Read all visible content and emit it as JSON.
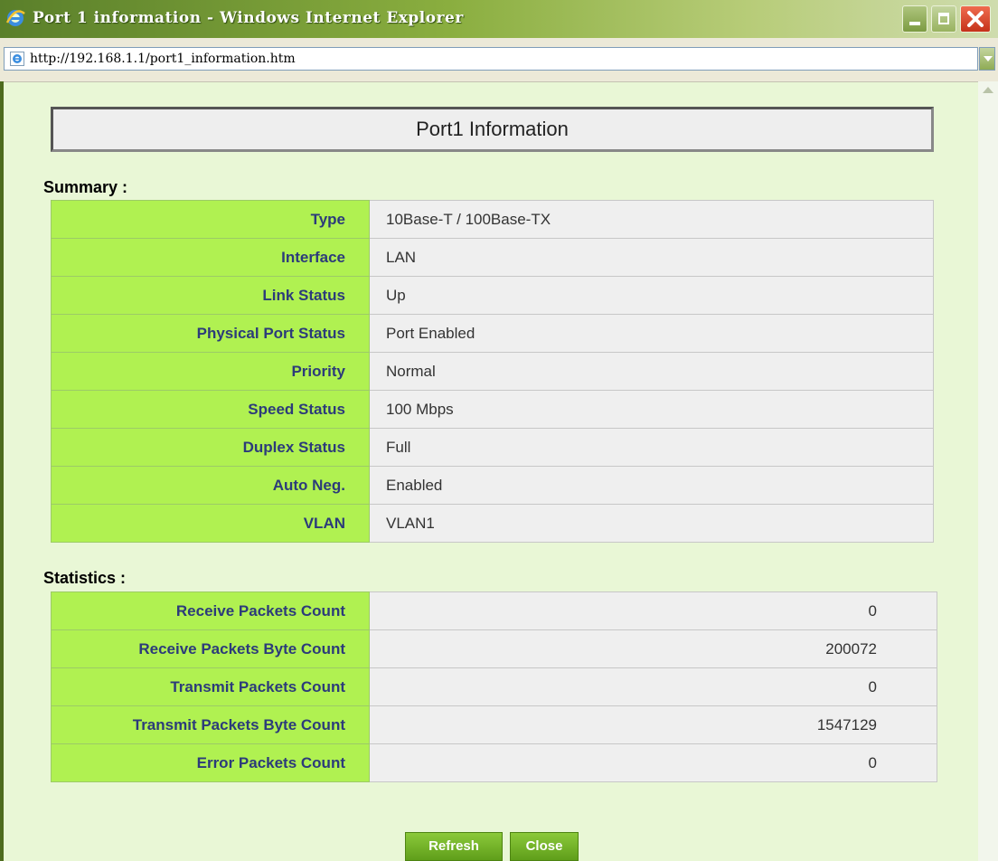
{
  "window": {
    "title": "Port 1 information - Windows Internet Explorer",
    "url": "http://192.168.1.1/port1_information.htm"
  },
  "page": {
    "heading": "Port1 Information"
  },
  "summary": {
    "label": "Summary :",
    "rows": [
      {
        "label": "Type",
        "value": "10Base-T / 100Base-TX"
      },
      {
        "label": "Interface",
        "value": "LAN"
      },
      {
        "label": "Link Status",
        "value": "Up"
      },
      {
        "label": "Physical Port Status",
        "value": "Port Enabled"
      },
      {
        "label": "Priority",
        "value": "Normal"
      },
      {
        "label": "Speed Status",
        "value": "100 Mbps"
      },
      {
        "label": "Duplex Status",
        "value": "Full"
      },
      {
        "label": "Auto Neg.",
        "value": "Enabled"
      },
      {
        "label": "VLAN",
        "value": "VLAN1"
      }
    ]
  },
  "statistics": {
    "label": "Statistics :",
    "rows": [
      {
        "label": "Receive Packets Count",
        "value": "0"
      },
      {
        "label": "Receive Packets Byte Count",
        "value": "200072"
      },
      {
        "label": "Transmit Packets Count",
        "value": "0"
      },
      {
        "label": "Transmit Packets Byte Count",
        "value": "1547129"
      },
      {
        "label": "Error Packets Count",
        "value": "0"
      }
    ]
  },
  "buttons": {
    "refresh": "Refresh",
    "close": "Close"
  },
  "colors": {
    "label_bg": "#b0f151",
    "label_text": "#2c3b7a",
    "page_bg": "#e9f7d6",
    "button_bg": "#6fb226"
  }
}
